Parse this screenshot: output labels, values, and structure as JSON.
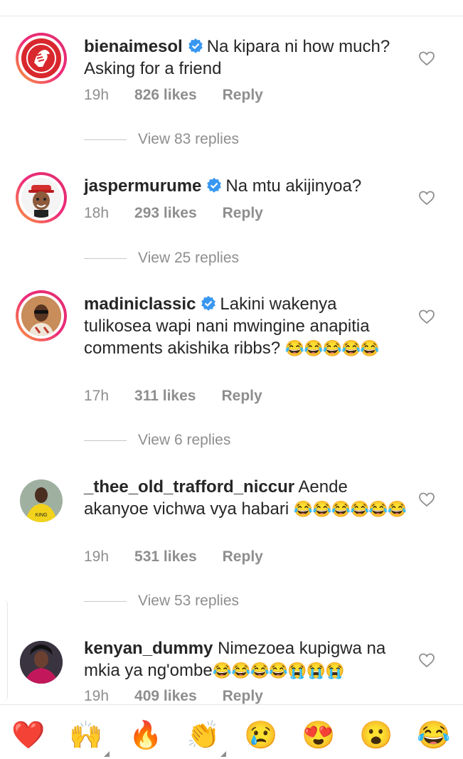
{
  "comments": [
    {
      "username": "bienaimesol",
      "verified": true,
      "text": "Na kipara ni how much? Asking for a friend",
      "emojis": "",
      "time": "19h",
      "likes": "826 likes",
      "reply": "Reply",
      "view_replies": "View 83 replies"
    },
    {
      "username": "jaspermurume",
      "verified": true,
      "text": "Na mtu akijinyoa?",
      "emojis": "",
      "time": "18h",
      "likes": "293 likes",
      "reply": "Reply",
      "view_replies": "View 25 replies"
    },
    {
      "username": "madiniclassic",
      "verified": true,
      "text": "Lakini wakenya tulikosea wapi nani mwingine anapitia comments akishika ribbs?",
      "emojis": "😂😂😂😂😂",
      "time": "17h",
      "likes": "311 likes",
      "reply": "Reply",
      "view_replies": "View 6 replies"
    },
    {
      "username": "_thee_old_trafford_niccur",
      "verified": false,
      "text": "Aende akanyoe vichwa vya habari",
      "emojis": "😂😂😂😂😂😂",
      "time": "19h",
      "likes": "531 likes",
      "reply": "Reply",
      "view_replies": "View 53 replies"
    },
    {
      "username": "kenyan_dummy",
      "verified": false,
      "text": "Nimezoea kupigwa na mkia ya ng'ombe",
      "emojis": "😂😂😂😂😭😭😭",
      "time": "19h",
      "likes": "409 likes",
      "reply": "Reply"
    }
  ],
  "reactions": [
    "❤️",
    "🙌",
    "🔥",
    "👏",
    "😢",
    "😍",
    "😮",
    "😂"
  ],
  "colors": {
    "text": "#262626",
    "secondary": "#8e8e8e",
    "verified_blue": "#3897f0",
    "ring_gradient_start": "#f9a13a",
    "ring_gradient_end": "#e1306c"
  },
  "icons": {
    "like": "heart-outline-icon",
    "verified": "verified-badge-icon"
  }
}
